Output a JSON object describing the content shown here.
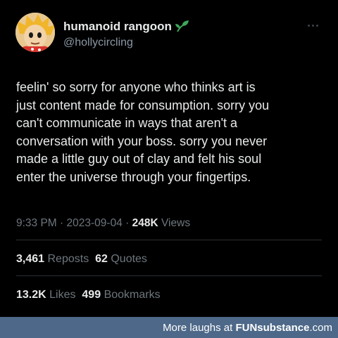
{
  "author": {
    "display_name": "humanoid rangoon",
    "handle": "@hollycircling",
    "avatar_icon": "cartoon-character-avatar",
    "name_icon": "sprout-icon"
  },
  "tweet": {
    "lines": [
      "feelin' so sorry for anyone who thinks art is",
      "just content made for consumption. sorry you",
      "can't communicate in ways that aren't a",
      "conversation with your boss. sorry you never",
      "made a little guy out of clay and felt his soul",
      "enter the universe through your fingertips."
    ],
    "time": "9:33 PM",
    "date": "2023-09-04",
    "separator": "·",
    "views_count": "248K",
    "views_label": "Views"
  },
  "stats": {
    "reposts_count": "3,461",
    "reposts_label": "Reposts",
    "quotes_count": "62",
    "quotes_label": "Quotes",
    "likes_count": "13.2K",
    "likes_label": "Likes",
    "bookmarks_count": "499",
    "bookmarks_label": "Bookmarks"
  },
  "footer": {
    "prefix": "More laughs at ",
    "brand_part1": "FUN",
    "brand_part2": "substance",
    "brand_part3": ".com"
  },
  "colors": {
    "background": "#000000",
    "text_primary": "#e7e9ea",
    "text_secondary": "#6e767d",
    "footer_background": "#4d6888",
    "sprout": "#3fa55b"
  }
}
